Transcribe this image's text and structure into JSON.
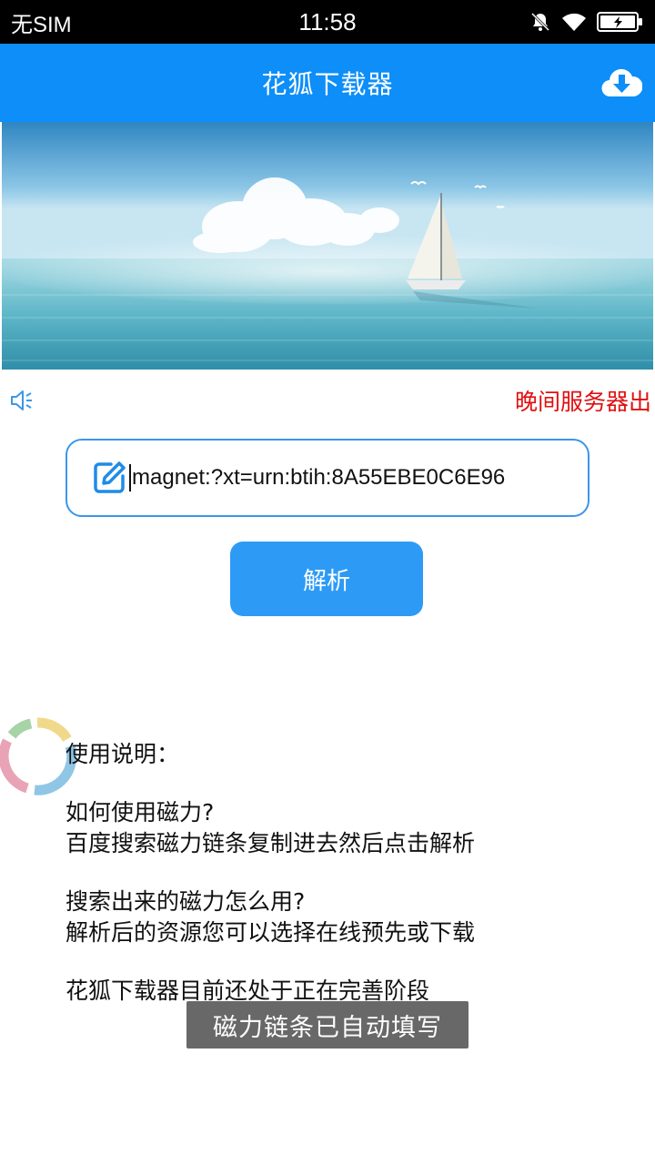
{
  "status_bar": {
    "carrier": "无SIM",
    "time": "11:58",
    "icons": [
      "mute-bell-icon",
      "wifi-icon",
      "battery-charging-icon"
    ]
  },
  "app_bar": {
    "title": "花狐下载器",
    "download_icon": "cloud-download-icon",
    "brand_color": "#0d8ef8"
  },
  "notice": {
    "icon": "speaker-icon",
    "text": "晚间服务器出",
    "color": "#e01010"
  },
  "input": {
    "icon": "edit-icon",
    "value": "magnet:?xt=urn:btih:8A55EBE0C6E96"
  },
  "parse_button": {
    "label": "解析"
  },
  "instructions": {
    "heading": "使用说明：",
    "q1": "如何使用磁力?",
    "a1": "百度搜索磁力链条复制进去然后点击解析",
    "q2": "搜索出来的磁力怎么用?",
    "a2": "解析后的资源您可以选择在线预先或下载",
    "note": "花狐下载器目前还处于正在完善阶段"
  },
  "toast": {
    "text": "磁力链条已自动填写"
  }
}
